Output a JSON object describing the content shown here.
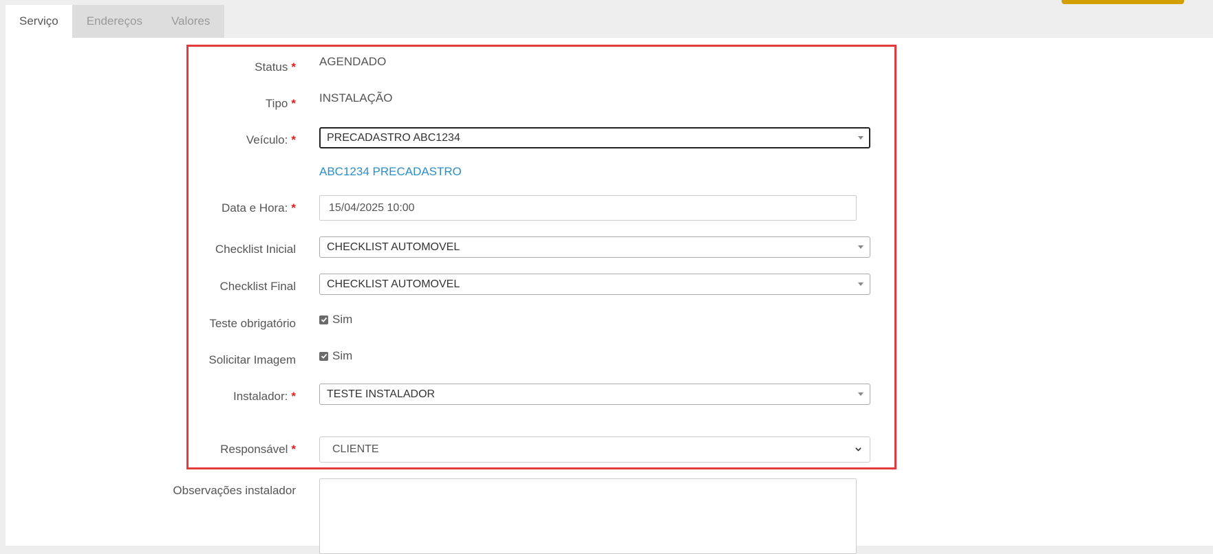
{
  "tabs": [
    {
      "label": "Serviço",
      "active": true
    },
    {
      "label": "Endereços",
      "active": false
    },
    {
      "label": "Valores",
      "active": false
    }
  ],
  "form": {
    "status": {
      "label": "Status",
      "value": "AGENDADO"
    },
    "tipo": {
      "label": "Tipo",
      "value": "INSTALAÇÃO"
    },
    "veiculo": {
      "label": "Veículo:",
      "value": "PRECADASTRO ABC1234",
      "link": "ABC1234 PRECADASTRO"
    },
    "data_hora": {
      "label": "Data e Hora:",
      "value": "15/04/2025 10:00"
    },
    "checklist_inicial": {
      "label": "Checklist Inicial",
      "value": "CHECKLIST AUTOMOVEL"
    },
    "checklist_final": {
      "label": "Checklist Final",
      "value": "CHECKLIST AUTOMOVEL"
    },
    "teste_obrigatorio": {
      "label": "Teste obrigatório",
      "option": "Sim",
      "checked": true
    },
    "solicitar_imagem": {
      "label": "Solicitar Imagem",
      "option": "Sim",
      "checked": true
    },
    "instalador": {
      "label": "Instalador:",
      "value": "TESTE INSTALADOR"
    },
    "responsavel": {
      "label": "Responsável",
      "value": "CLIENTE"
    },
    "observacoes": {
      "label": "Observações instalador",
      "value": ""
    }
  },
  "required_marker": "*",
  "colors": {
    "accent": "#d39e00",
    "highlight": "#e6393b",
    "required": "#e02020",
    "link": "#2a8fc8"
  }
}
